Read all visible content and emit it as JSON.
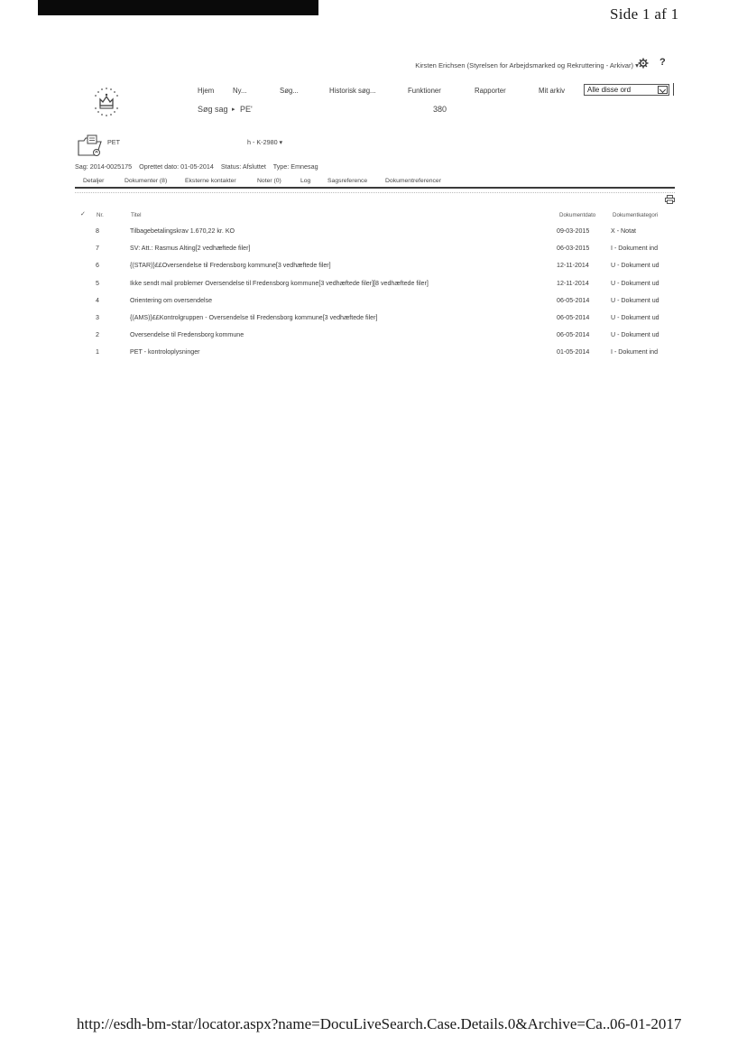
{
  "print": {
    "page_label": "Side 1 af 1",
    "footer_url": "http://esdh-bm-star/locator.aspx?name=DocuLiveSearch.Case.Details.0&Archive=Ca...",
    "footer_date": "06-01-2017"
  },
  "user_bar": {
    "user": "Kirsten Erichsen (Styrelsen for Arbejdsmarked og Rekruttering - Arkivar) ▾",
    "help": "?"
  },
  "nav": {
    "home": "Hjem",
    "new": "Ny...",
    "search": "Søg...",
    "history_search": "Historisk søg...",
    "functions": "Funktioner",
    "reports": "Rapporter",
    "my_archive": "Mit arkiv",
    "search_mode_value": "Alle disse ord"
  },
  "breadcrumb": {
    "first": "Søg sag",
    "separator": "▸",
    "second": "PE'",
    "number": "380"
  },
  "case": {
    "name": "PET",
    "title": "h - K-2980 ▾",
    "case_no": "Sag: 2014-0025175",
    "created": "Oprettet dato: 01-05-2014",
    "status": "Status: Afsluttet",
    "type": "Type: Emnesag"
  },
  "tabs": [
    {
      "label": "Detaljer"
    },
    {
      "label": "Dokumenter (8)"
    },
    {
      "label": "Eksterne kontakter"
    },
    {
      "label": "Noter (0)"
    },
    {
      "label": "Log"
    },
    {
      "label": "Sagsreference"
    },
    {
      "label": "Dokumentreferencer"
    }
  ],
  "table": {
    "check_header": "✓",
    "headers": {
      "nr": "Nr.",
      "title": "Titel",
      "date": "Dokumentdato",
      "category": "Dokumentkategori"
    },
    "rows": [
      {
        "nr": "8",
        "title": "Tilbagebetalingskrav 1.670,22 kr. KO",
        "date": "09-03-2015",
        "category": "X - Notat"
      },
      {
        "nr": "7",
        "title": "SV: Att.: Rasmus Alting[2 vedhæftede filer]",
        "date": "06-03-2015",
        "category": "I - Dokument ind"
      },
      {
        "nr": "6",
        "title": "{(STAR)}££Oversendelse til Fredensborg kommune[3 vedhæftede filer]",
        "date": "12-11-2014",
        "category": "U - Dokument ud"
      },
      {
        "nr": "5",
        "title": "Ikke sendt mail problemer Oversendelse til Fredensborg kommune[3 vedhæftede filer][8 vedhæftede filer]",
        "date": "12-11-2014",
        "category": "U - Dokument ud"
      },
      {
        "nr": "4",
        "title": "Orientering om oversendelse",
        "date": "06-05-2014",
        "category": "U - Dokument ud"
      },
      {
        "nr": "3",
        "title": "{(AMS)}££Kontrolgruppen - Oversendelse til Fredensborg kommune[3 vedhæftede filer]",
        "date": "06-05-2014",
        "category": "U - Dokument ud"
      },
      {
        "nr": "2",
        "title": "Oversendelse til Fredensborg kommune",
        "date": "06-05-2014",
        "category": "U - Dokument ud"
      },
      {
        "nr": "1",
        "title": "PET - kontroloplysninger",
        "date": "01-05-2014",
        "category": "I - Dokument ind"
      }
    ]
  }
}
